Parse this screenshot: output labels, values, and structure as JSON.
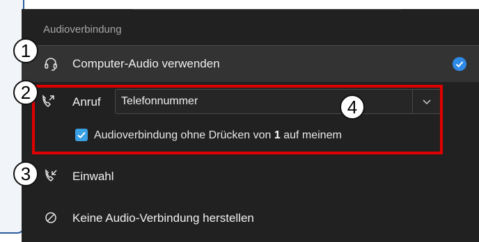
{
  "section_title": "Audioverbindung",
  "options": {
    "computer_audio": "Computer-Audio verwenden",
    "call_label": "Anruf",
    "call_dropdown_value": "Telefonnummer",
    "checkbox_label_before": "Audioverbindung ohne Drücken von ",
    "checkbox_label_bold": "1",
    "checkbox_label_after": " auf meinem",
    "dial_in": "Einwahl",
    "no_audio": "Keine Audio-Verbindung herstellen"
  },
  "annotations": [
    "1",
    "2",
    "3",
    "4"
  ],
  "colors": {
    "panel_bg": "#212121",
    "selected_row_bg": "#333333",
    "accent_blue": "#2f8ae6",
    "annotation_red": "#e00000"
  },
  "icons": {
    "computer_audio": "headset-icon",
    "call": "phone-outgoing-icon",
    "dial_in": "phone-incoming-icon",
    "no_audio": "prohibited-icon",
    "selected": "checkmark-circle-icon",
    "dropdown": "chevron-down-icon"
  }
}
